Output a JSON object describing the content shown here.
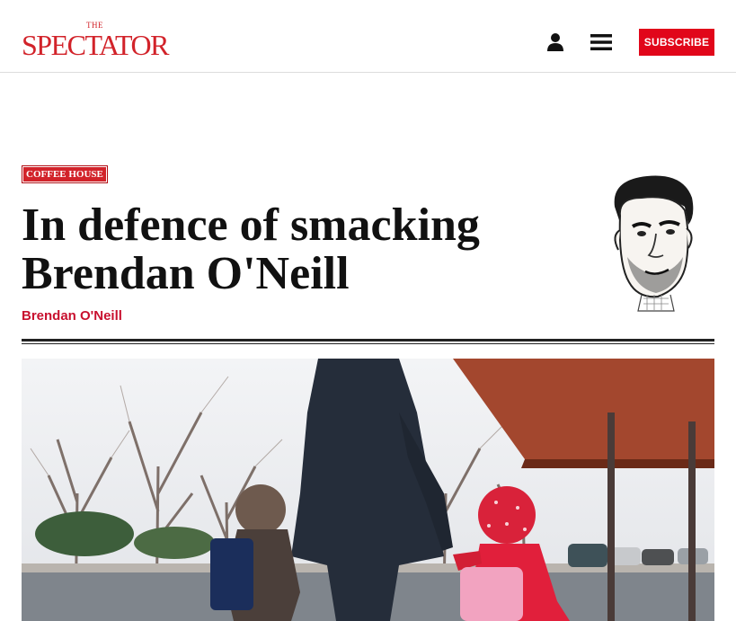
{
  "header": {
    "logo_small": "THE",
    "logo_main": "SPECTATOR",
    "user_icon": "user-icon",
    "menu_icon": "hamburger-menu-icon",
    "subscribe_label": "SUBSCRIBE"
  },
  "article": {
    "category": "COFFEE HOUSE",
    "title_line1": "In defence of smacking",
    "title_line2": "Brendan O'Neill",
    "author": "Brendan O'Neill"
  },
  "colors": {
    "brand_red": "#d2232a",
    "subscribe_red": "#e1061a",
    "byline_red": "#c8102e"
  }
}
